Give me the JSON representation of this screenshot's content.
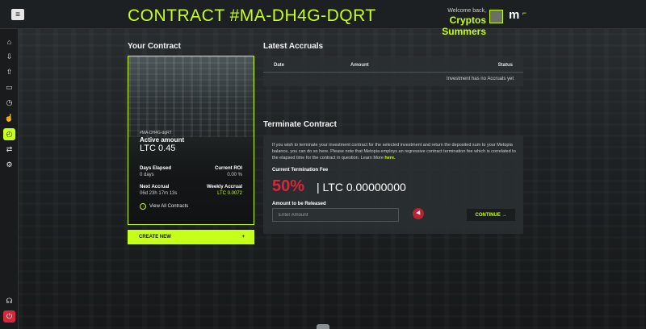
{
  "header": {
    "title": "CONTRACT #MA-DH4G-DQRT",
    "welcome_text": "Welcome back,",
    "username": "Cryptos Summers",
    "logo_letter": "m",
    "menu_icon": "menu-toggle-icon"
  },
  "sidebar": {
    "items": [
      {
        "name": "home",
        "icon": "home-icon",
        "glyph": "⌂"
      },
      {
        "name": "download",
        "icon": "download-icon",
        "glyph": "⇩"
      },
      {
        "name": "upload",
        "icon": "upload-icon",
        "glyph": "⇧"
      },
      {
        "name": "folder",
        "icon": "folder-icon",
        "glyph": "▭"
      },
      {
        "name": "history",
        "icon": "clock-icon",
        "glyph": "◷"
      },
      {
        "name": "likes",
        "icon": "thumbs-up-icon",
        "glyph": "☝"
      },
      {
        "name": "contracts",
        "icon": "contract-icon",
        "glyph": "◴"
      },
      {
        "name": "transfer",
        "icon": "transfer-icon",
        "glyph": "⇄"
      },
      {
        "name": "settings",
        "icon": "gear-icon",
        "glyph": "⚙"
      }
    ],
    "bottom": [
      {
        "name": "support",
        "icon": "headset-icon",
        "glyph": "☊"
      },
      {
        "name": "logout",
        "icon": "power-icon",
        "glyph": "⏻"
      }
    ]
  },
  "contract": {
    "section_title": "Your Contract",
    "id": "#MA-DH4G-dqRT",
    "active_label": "Active amount",
    "active_amount": "LTC 0.45",
    "days_elapsed_label": "Days Elapsed",
    "days_elapsed_value": "0 days",
    "roi_label": "Current ROI",
    "roi_value": "0.00 %",
    "next_accrual_label": "Next Accrual",
    "next_accrual_value": "06d 23h 17m 13s",
    "weekly_accrual_label": "Weekly Accrual",
    "weekly_accrual_value": "LTC 0.0072",
    "view_all_label": "View All Contracts",
    "create_new_label": "CREATE NEW",
    "create_new_plus": "+"
  },
  "accruals": {
    "section_title": "Latest Accruals",
    "columns": [
      "Date",
      "Amount",
      "Status"
    ],
    "empty_message": "Investment has no Accruals yet"
  },
  "terminate": {
    "section_title": "Terminate Contract",
    "description": "If you wish to terminate your investment contract for the selected investment and return the deposited sum to your Metopia balance, you can do so here. Please note that Metopia employs an regressive contract termination fee which is correlated to the elapsed time for the contract in question. Learn More",
    "learn_more_link": "here.",
    "fee_label": "Current Termination Fee",
    "fee_percent": "50%",
    "fee_amount": "| LTC 0.00000000",
    "amount_label": "Amount to be Released",
    "amount_placeholder": "Enter Amount",
    "amount_value": "",
    "continue_label": "CONTINUE →"
  },
  "colors": {
    "accent": "#c6ff1a",
    "danger": "#d8263a",
    "panel": "#2a3032"
  }
}
